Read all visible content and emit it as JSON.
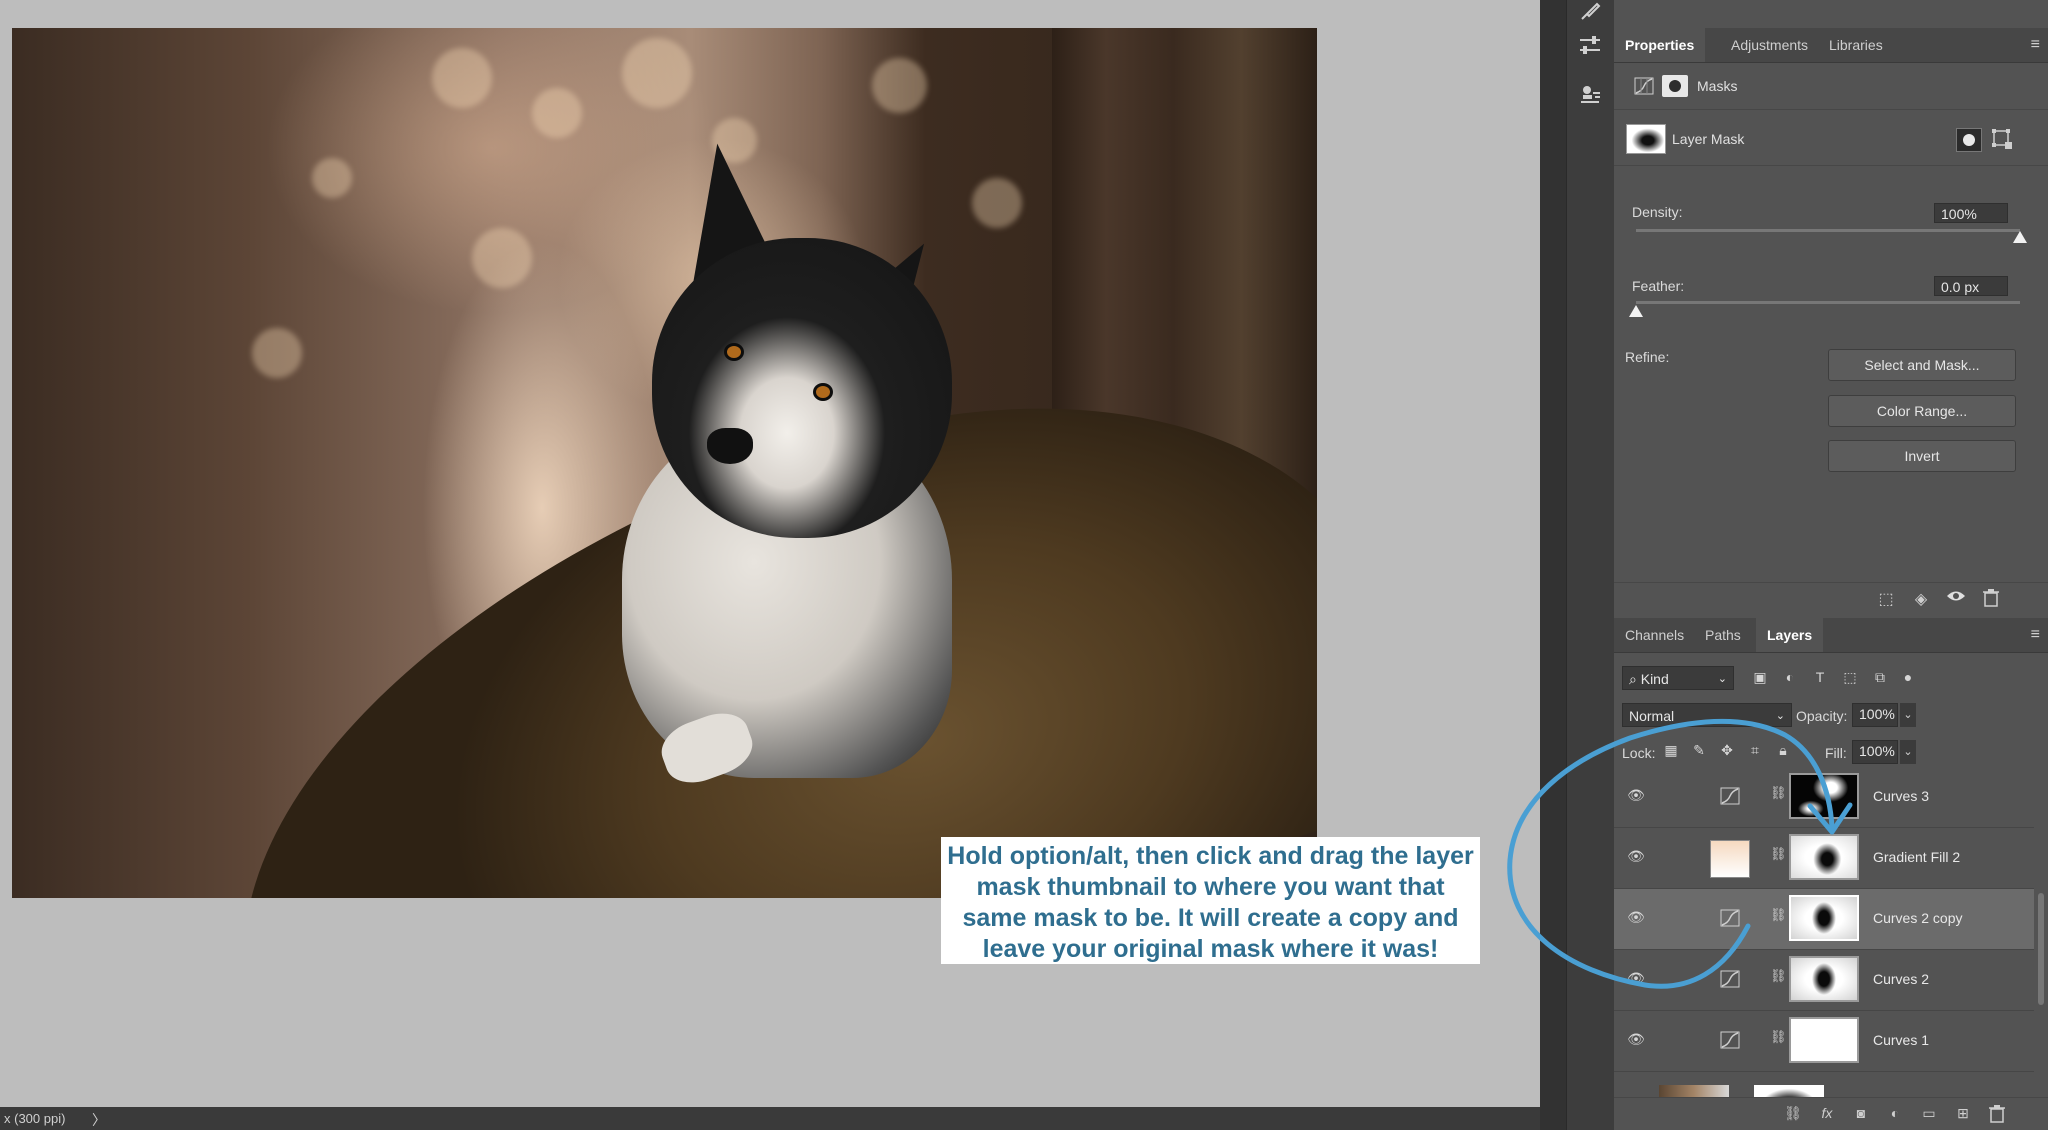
{
  "canvas": {
    "callout_text": "Hold option/alt, then click and drag the layer mask thumbnail to where you want that same mask to be. It will create a copy and leave your original mask where it was!",
    "status_text": "x (300 ppi)",
    "status_chevron": "〉"
  },
  "properties": {
    "tabs": [
      "Properties",
      "Adjustments",
      "Libraries"
    ],
    "masks_label": "Masks",
    "layer_mask_label": "Layer Mask",
    "density_label": "Density:",
    "density_value": "100%",
    "density_fraction": 1.0,
    "feather_label": "Feather:",
    "feather_value": "0.0 px",
    "feather_fraction": 0.0,
    "refine_label": "Refine:",
    "buttons": {
      "select_and_mask": "Select and Mask...",
      "color_range": "Color Range...",
      "invert": "Invert"
    }
  },
  "layers_panel": {
    "tabs": [
      "Channels",
      "Paths",
      "Layers"
    ],
    "kind_label": "Kind",
    "blend_mode": "Normal",
    "opacity_label": "Opacity:",
    "opacity_value": "100%",
    "lock_label": "Lock:",
    "fill_label": "Fill:",
    "fill_value": "100%",
    "layers": [
      {
        "name": "Curves 3",
        "type": "curves",
        "selected": false
      },
      {
        "name": "Gradient Fill 2",
        "type": "gradient",
        "selected": false
      },
      {
        "name": "Curves 2 copy",
        "type": "curves",
        "selected": true
      },
      {
        "name": "Curves 2",
        "type": "curves",
        "selected": false
      },
      {
        "name": "Curves 1",
        "type": "curves",
        "selected": false
      }
    ]
  },
  "icons": {
    "eye": "eye-icon",
    "link": "chain-link-icon",
    "curves": "curves-adjustment-icon",
    "menu": "hamburger-menu-icon"
  },
  "colors": {
    "callout_text": "#2f6e8f",
    "annotation_arrow": "#4a9fd3",
    "panel_bg": "#535353"
  }
}
